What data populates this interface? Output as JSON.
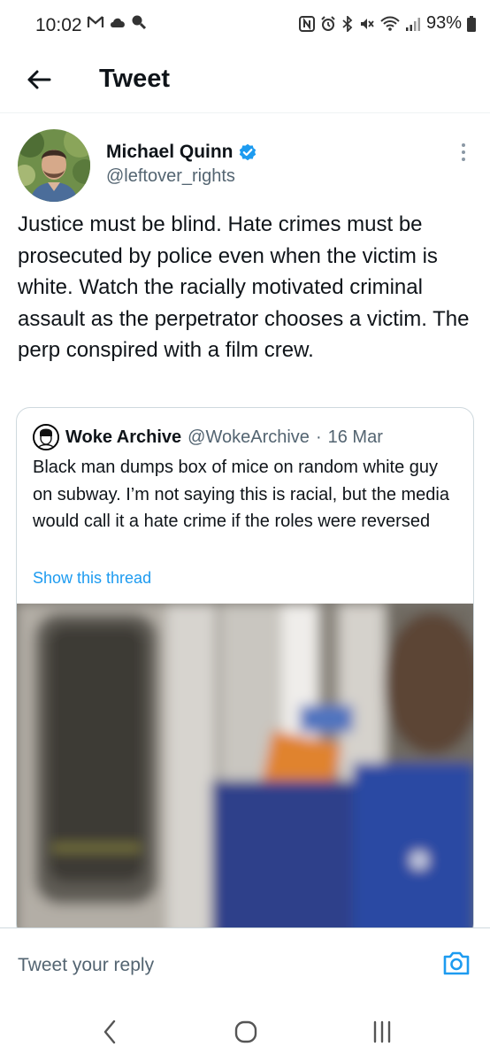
{
  "status_bar": {
    "time": "10:02",
    "battery": "93%"
  },
  "header": {
    "title": "Tweet"
  },
  "tweet": {
    "author_name": "Michael Quinn",
    "author_handle": "@leftover_rights",
    "verified": true,
    "text": "Justice must be blind.  Hate crimes must be prosecuted by police even when the victim is white.  Watch the racially motivated criminal assault as the perpetrator chooses a victim.  The perp conspired with a film crew."
  },
  "quoted_tweet": {
    "author_name": "Woke Archive",
    "author_handle": "@WokeArchive",
    "separator": "·",
    "date": "16 Mar",
    "text": "Black man dumps box of mice on random white guy on subway. I’m not saying this is racial, but the media would call it a hate crime if the roles were reversed",
    "show_thread_label": "Show this thread"
  },
  "reply": {
    "placeholder": "Tweet your reply"
  },
  "colors": {
    "accent": "#1d9bf0",
    "text_primary": "#0f1419",
    "text_secondary": "#536471",
    "border": "#cfd9de"
  },
  "icons": {
    "back": "arrow-left-icon",
    "verified": "verified-badge-icon",
    "more": "more-vertical-icon",
    "camera": "camera-icon",
    "nav_back": "chevron-left-icon",
    "nav_home": "circle-home-icon",
    "nav_recents": "recents-icon"
  }
}
